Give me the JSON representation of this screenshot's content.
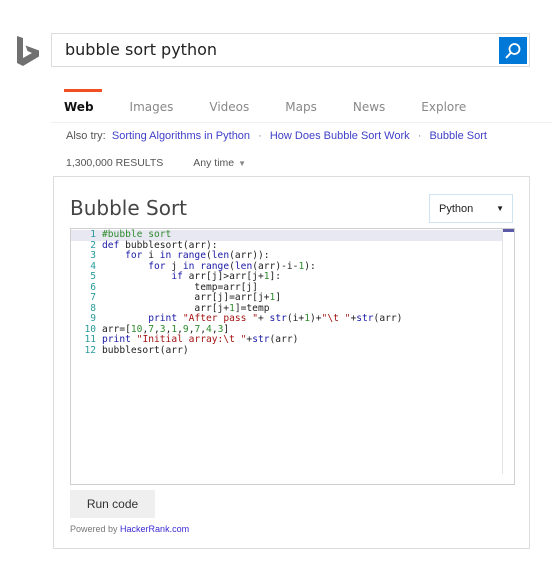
{
  "search": {
    "query": "bubble sort python",
    "button_icon": "search-icon"
  },
  "brand": {
    "logo_icon": "bing-logo-icon",
    "accent": "#f25022",
    "search_button_color": "#0078d7"
  },
  "tabs": [
    {
      "label": "Web",
      "active": true
    },
    {
      "label": "Images",
      "active": false
    },
    {
      "label": "Videos",
      "active": false
    },
    {
      "label": "Maps",
      "active": false
    },
    {
      "label": "News",
      "active": false
    },
    {
      "label": "Explore",
      "active": false
    }
  ],
  "also_try": {
    "label": "Also try:",
    "links": [
      "Sorting Algorithms in Python",
      "How Does Bubble Sort Work",
      "Bubble Sort"
    ],
    "separator": "·"
  },
  "results": {
    "count": "1,300,000 RESULTS",
    "time_filter": "Any time",
    "time_filter_icon": "caret-down-icon"
  },
  "card": {
    "title": "Bubble Sort",
    "language": "Python",
    "language_icon": "dropdown-arrow-icon",
    "code_lines": [
      {
        "n": "1",
        "code": "#bubble sort"
      },
      {
        "n": "2",
        "code": "def bubblesort(arr):"
      },
      {
        "n": "3",
        "code": "    for i in range(len(arr)):"
      },
      {
        "n": "4",
        "code": "        for j in range(len(arr)-i-1):"
      },
      {
        "n": "5",
        "code": "            if arr[j]>arr[j+1]:"
      },
      {
        "n": "6",
        "code": "                temp=arr[j]"
      },
      {
        "n": "7",
        "code": "                arr[j]=arr[j+1]"
      },
      {
        "n": "8",
        "code": "                arr[j+1]=temp"
      },
      {
        "n": "9",
        "code": "        print \"After pass \"+ str(i+1)+\"\\t \"+str(arr)"
      },
      {
        "n": "10",
        "code": "arr=[10,7,3,1,9,7,4,3]"
      },
      {
        "n": "11",
        "code": "print \"Initial array:\\t \"+str(arr)"
      },
      {
        "n": "12",
        "code": "bubblesort(arr)"
      }
    ],
    "run_label": "Run code",
    "powered_by_label": "Powered by",
    "powered_by_link": "HackerRank.com"
  }
}
